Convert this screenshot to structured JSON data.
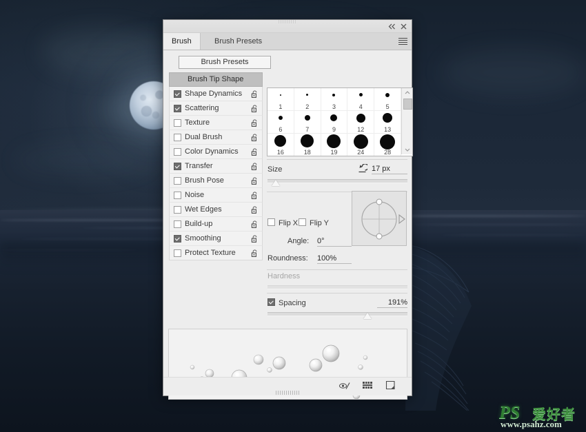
{
  "window": {
    "collapse_icon": "double-chevron-left-icon",
    "close_icon": "close-icon",
    "menu_icon": "panel-menu-icon"
  },
  "tabs": [
    {
      "label": "Brush",
      "active": true
    },
    {
      "label": "Brush Presets",
      "active": false
    }
  ],
  "presets_button": {
    "label": "Brush Presets"
  },
  "options": {
    "header": {
      "label": "Brush Tip Shape"
    },
    "items": [
      {
        "label": "Shape Dynamics",
        "checked": true,
        "lock": "unlocked-padlock-icon"
      },
      {
        "label": "Scattering",
        "checked": true,
        "lock": "unlocked-padlock-icon"
      },
      {
        "label": "Texture",
        "checked": false,
        "lock": "unlocked-padlock-icon"
      },
      {
        "label": "Dual Brush",
        "checked": false,
        "lock": "unlocked-padlock-icon"
      },
      {
        "label": "Color Dynamics",
        "checked": false,
        "lock": "unlocked-padlock-icon"
      },
      {
        "label": "Transfer",
        "checked": true,
        "lock": "unlocked-padlock-icon"
      },
      {
        "label": "Brush Pose",
        "checked": false,
        "lock": "unlocked-padlock-icon"
      },
      {
        "label": "Noise",
        "checked": false,
        "lock": "unlocked-padlock-icon"
      },
      {
        "label": "Wet Edges",
        "checked": false,
        "lock": "unlocked-padlock-icon"
      },
      {
        "label": "Build-up",
        "checked": false,
        "lock": "unlocked-padlock-icon"
      },
      {
        "label": "Smoothing",
        "checked": true,
        "lock": "unlocked-padlock-icon"
      },
      {
        "label": "Protect Texture",
        "checked": false,
        "lock": "unlocked-padlock-icon"
      }
    ]
  },
  "brush_grid": {
    "rows": [
      [
        {
          "num": "1",
          "size": 2
        },
        {
          "num": "2",
          "size": 3
        },
        {
          "num": "3",
          "size": 4
        },
        {
          "num": "4",
          "size": 5
        },
        {
          "num": "5",
          "size": 6
        }
      ],
      [
        {
          "num": "6",
          "size": 6
        },
        {
          "num": "7",
          "size": 7
        },
        {
          "num": "9",
          "size": 9
        },
        {
          "num": "12",
          "size": 12
        },
        {
          "num": "13",
          "size": 13
        }
      ],
      [
        {
          "num": "16",
          "size": 16
        },
        {
          "num": "18",
          "size": 18
        },
        {
          "num": "19",
          "size": 19
        },
        {
          "num": "24",
          "size": 21
        },
        {
          "num": "28",
          "size": 22
        }
      ]
    ],
    "scroll_up_icon": "chevron-up-icon",
    "scroll_down_icon": "chevron-down-icon"
  },
  "controls": {
    "size": {
      "label": "Size",
      "value": "17 px",
      "reset_icon": "reset-arrow-icon",
      "slider_percent": 6
    },
    "flip_x": {
      "label": "Flip X",
      "checked": false
    },
    "flip_y": {
      "label": "Flip Y",
      "checked": false
    },
    "angle": {
      "label": "Angle:",
      "value": "0°"
    },
    "roundness": {
      "label": "Roundness:",
      "value": "100%"
    },
    "hardness": {
      "label": "Hardness",
      "value": "",
      "disabled": true,
      "slider_percent": 0
    },
    "spacing": {
      "label": "Spacing",
      "checked": true,
      "value": "191%",
      "slider_percent": 72
    }
  },
  "bottom_bar": {
    "icons": [
      {
        "name": "toggle-live-tip-brush-preview-icon"
      },
      {
        "name": "brush-panel-icon"
      },
      {
        "name": "create-new-brush-icon"
      }
    ]
  },
  "watermark": {
    "ps": "PS",
    "cn": "爱好者",
    "url": "www.psahz.com"
  },
  "colors": {
    "panel_bg": "#ededed",
    "panel_border": "#8e8e8e",
    "header_bg": "#bfbfbf",
    "background_sky": "#1b2737",
    "watermark_green": "#2f7d32"
  }
}
